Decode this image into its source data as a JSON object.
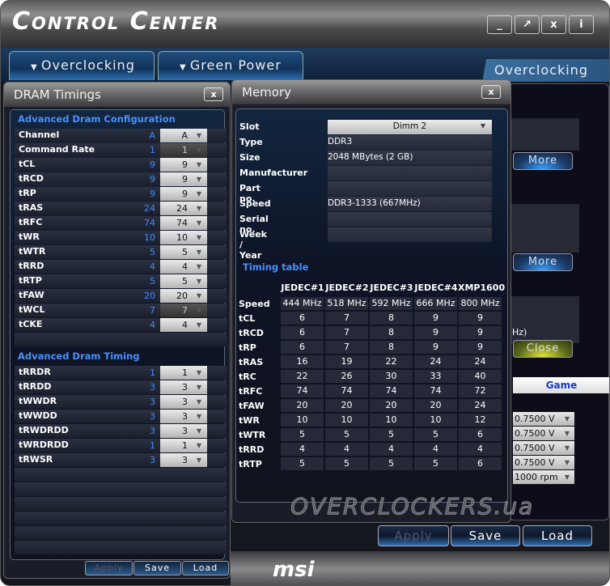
{
  "app": {
    "title": "Control Center",
    "window_buttons": [
      {
        "icon": "minimize-icon",
        "glyph": "_"
      },
      {
        "icon": "restore-icon",
        "glyph": "↗"
      },
      {
        "icon": "close-icon",
        "glyph": "x"
      },
      {
        "icon": "info-icon",
        "glyph": "i"
      }
    ]
  },
  "tabs": [
    {
      "label": "Overclocking"
    },
    {
      "label": "Green Power"
    }
  ],
  "active_section": "Overclocking",
  "background_panel": {
    "more1": "More",
    "more2": "More",
    "freq_suffix": "Hz)",
    "close": "Close",
    "game_tab": "Game",
    "selects": [
      "0.7500 V",
      "0.7500 V",
      "0.7500 V",
      "0.7500 V",
      "1000 rpm"
    ]
  },
  "bottom_buttons": {
    "apply": "Apply",
    "save": "Save",
    "load": "Load"
  },
  "watermark": "OVERCLOCKERS.ua",
  "brand": "msi",
  "dram": {
    "title": "DRAM Timings",
    "close": "x",
    "config_header": "Advanced Dram Configuration",
    "config": [
      {
        "label": "Channel",
        "current": "A",
        "value": "A"
      },
      {
        "label": "Command Rate",
        "current": "1",
        "value": "1",
        "disabled": true
      },
      {
        "label": "tCL",
        "current": "9",
        "value": "9"
      },
      {
        "label": "tRCD",
        "current": "9",
        "value": "9"
      },
      {
        "label": "tRP",
        "current": "9",
        "value": "9"
      },
      {
        "label": "tRAS",
        "current": "24",
        "value": "24"
      },
      {
        "label": "tRFC",
        "current": "74",
        "value": "74"
      },
      {
        "label": "tWR",
        "current": "10",
        "value": "10"
      },
      {
        "label": "tWTR",
        "current": "5",
        "value": "5"
      },
      {
        "label": "tRRD",
        "current": "4",
        "value": "4"
      },
      {
        "label": "tRTP",
        "current": "5",
        "value": "5"
      },
      {
        "label": "tFAW",
        "current": "20",
        "value": "20"
      },
      {
        "label": "tWCL",
        "current": "7",
        "value": "7",
        "disabled": true
      },
      {
        "label": "tCKE",
        "current": "4",
        "value": "4"
      }
    ],
    "timing_header": "Advanced Dram Timing",
    "timing": [
      {
        "label": "tRRDR",
        "current": "1",
        "value": "1"
      },
      {
        "label": "tRRDD",
        "current": "3",
        "value": "3"
      },
      {
        "label": "tWWDR",
        "current": "3",
        "value": "3"
      },
      {
        "label": "tWWDD",
        "current": "3",
        "value": "3"
      },
      {
        "label": "tRWDRDD",
        "current": "3",
        "value": "3"
      },
      {
        "label": "tWRDRDD",
        "current": "1",
        "value": "1"
      },
      {
        "label": "tRWSR",
        "current": "3",
        "value": "3"
      }
    ],
    "buttons": {
      "apply": "Apply",
      "save": "Save",
      "load": "Load"
    }
  },
  "memory": {
    "title": "Memory",
    "close": "x",
    "fields": [
      {
        "label": "Slot",
        "value": "Dimm 2",
        "dropdown": true
      },
      {
        "label": "Type",
        "value": "DDR3"
      },
      {
        "label": "Size",
        "value": "2048 MBytes (2 GB)"
      },
      {
        "label": "Manufacturer",
        "value": ""
      },
      {
        "label": "Part no.",
        "value": ""
      },
      {
        "label": "Speed",
        "value": "DDR3-1333 (667MHz)"
      },
      {
        "label": "Serial no.",
        "value": ""
      },
      {
        "label": "Week / Year",
        "value": ""
      }
    ],
    "timing_table": {
      "title": "Timing table",
      "columns": [
        "JEDEC#1",
        "JEDEC#2",
        "JEDEC#3",
        "JEDEC#4",
        "XMP1600"
      ],
      "rows": [
        {
          "label": "Speed",
          "values": [
            "444 MHz",
            "518 MHz",
            "592 MHz",
            "666 MHz",
            "800 MHz"
          ]
        },
        {
          "label": "tCL",
          "values": [
            "6",
            "7",
            "8",
            "9",
            "9"
          ]
        },
        {
          "label": "tRCD",
          "values": [
            "6",
            "7",
            "8",
            "9",
            "9"
          ]
        },
        {
          "label": "tRP",
          "values": [
            "6",
            "7",
            "8",
            "9",
            "9"
          ]
        },
        {
          "label": "tRAS",
          "values": [
            "16",
            "19",
            "22",
            "24",
            "24"
          ]
        },
        {
          "label": "tRC",
          "values": [
            "22",
            "26",
            "30",
            "33",
            "40"
          ]
        },
        {
          "label": "tRFC",
          "values": [
            "74",
            "74",
            "74",
            "74",
            "72"
          ]
        },
        {
          "label": "tFAW",
          "values": [
            "20",
            "20",
            "20",
            "20",
            "24"
          ]
        },
        {
          "label": "tWR",
          "values": [
            "10",
            "10",
            "10",
            "10",
            "12"
          ]
        },
        {
          "label": "tWTR",
          "values": [
            "5",
            "5",
            "5",
            "5",
            "6"
          ]
        },
        {
          "label": "tRRD",
          "values": [
            "4",
            "4",
            "4",
            "4",
            "4"
          ]
        },
        {
          "label": "tRTP",
          "values": [
            "5",
            "5",
            "5",
            "5",
            "6"
          ]
        }
      ]
    }
  }
}
